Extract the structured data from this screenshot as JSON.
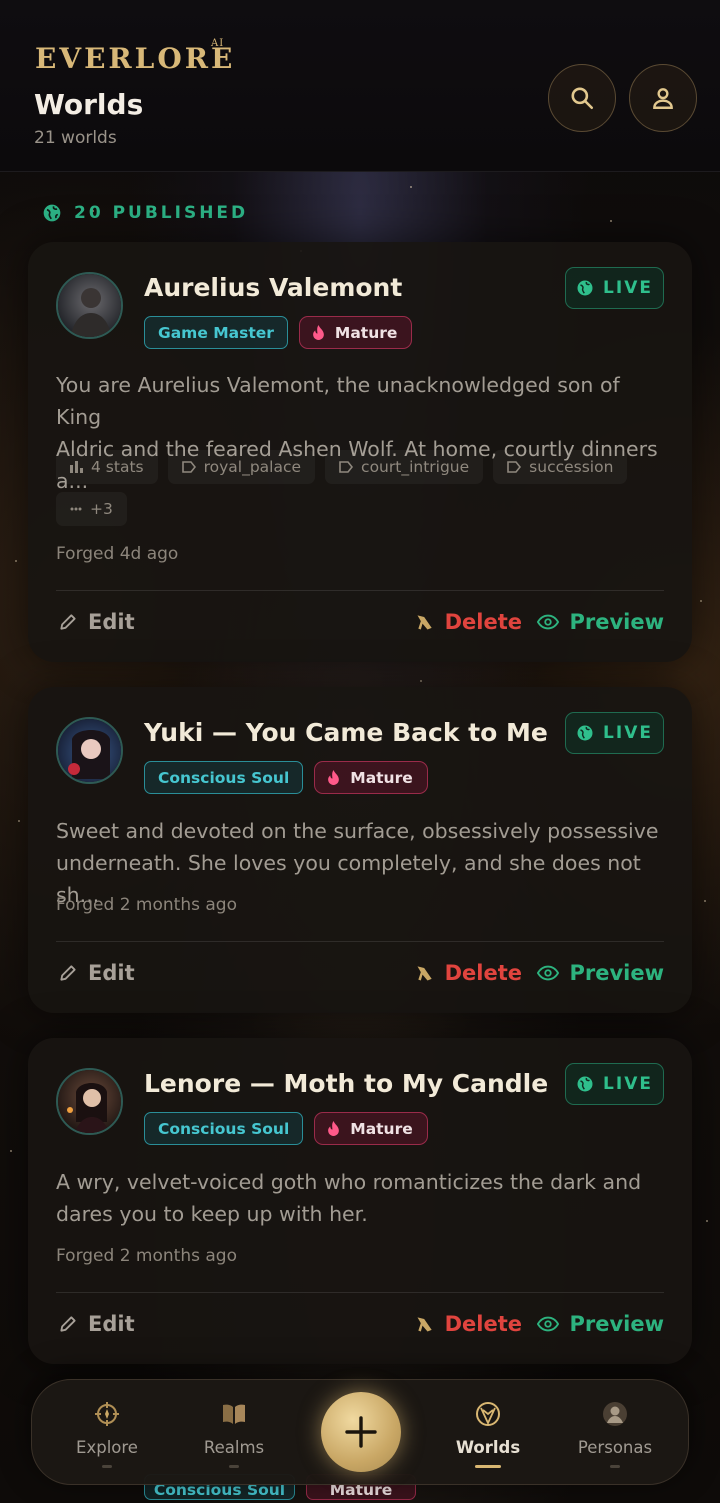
{
  "app": {
    "logo": "EVERLORE",
    "logo_sup": "AI"
  },
  "header": {
    "title": "Worlds",
    "subtitle": "21 worlds"
  },
  "section": {
    "label": "20 PUBLISHED"
  },
  "cards": [
    {
      "title": "Aurelius Valemont",
      "status": "LIVE",
      "type": "Game Master",
      "rating": "Mature",
      "description_line1": "You are Aurelius Valemont, the unacknowledged son of King",
      "description_line2": "Aldric and the feared Ashen Wolf. At home, courtly dinners a...",
      "chips": [
        {
          "icon": "bar-chart-icon",
          "label": "4 stats"
        },
        {
          "icon": "tag-icon",
          "label": "royal_palace"
        },
        {
          "icon": "tag-icon",
          "label": "court_intrigue"
        },
        {
          "icon": "tag-icon",
          "label": "succession"
        },
        {
          "icon": "more-icon",
          "label": "+3"
        }
      ],
      "forged": "Forged 4d ago",
      "actions": {
        "edit": "Edit",
        "delete": "Delete",
        "preview": "Preview"
      }
    },
    {
      "title": "Yuki — You Came Back to Me",
      "status": "LIVE",
      "type": "Conscious Soul",
      "rating": "Mature",
      "description_line1": "Sweet and devoted on the surface, obsessively possessive",
      "description_line2": "underneath. She loves you completely, and she does not sh...",
      "forged": "Forged 2 months ago",
      "actions": {
        "edit": "Edit",
        "delete": "Delete",
        "preview": "Preview"
      }
    },
    {
      "title": "Lenore — Moth to My Candle",
      "status": "LIVE",
      "type": "Conscious Soul",
      "rating": "Mature",
      "description_line1": "A wry, velvet-voiced goth who romanticizes the dark and",
      "description_line2": "dares you to keep up with her.",
      "forged": "Forged 2 months ago",
      "actions": {
        "edit": "Edit",
        "delete": "Delete",
        "preview": "Preview"
      }
    }
  ],
  "peek_card": {
    "type": "Conscious Soul",
    "rating": "Mature"
  },
  "nav": {
    "items": [
      {
        "label": "Explore",
        "icon": "compass-icon",
        "active": false
      },
      {
        "label": "Realms",
        "icon": "book-icon",
        "active": false
      },
      {
        "label": "Worlds",
        "icon": "globe-icon",
        "active": true
      },
      {
        "label": "Personas",
        "icon": "person-icon",
        "active": false
      }
    ],
    "fab_icon": "plus-icon"
  },
  "colors": {
    "accent_gold": "#d9b772",
    "live_green": "#2fbf8c",
    "delete_red": "#e0443e",
    "teal": "#46c6d0",
    "mature_pink": "#9a2b4a"
  }
}
